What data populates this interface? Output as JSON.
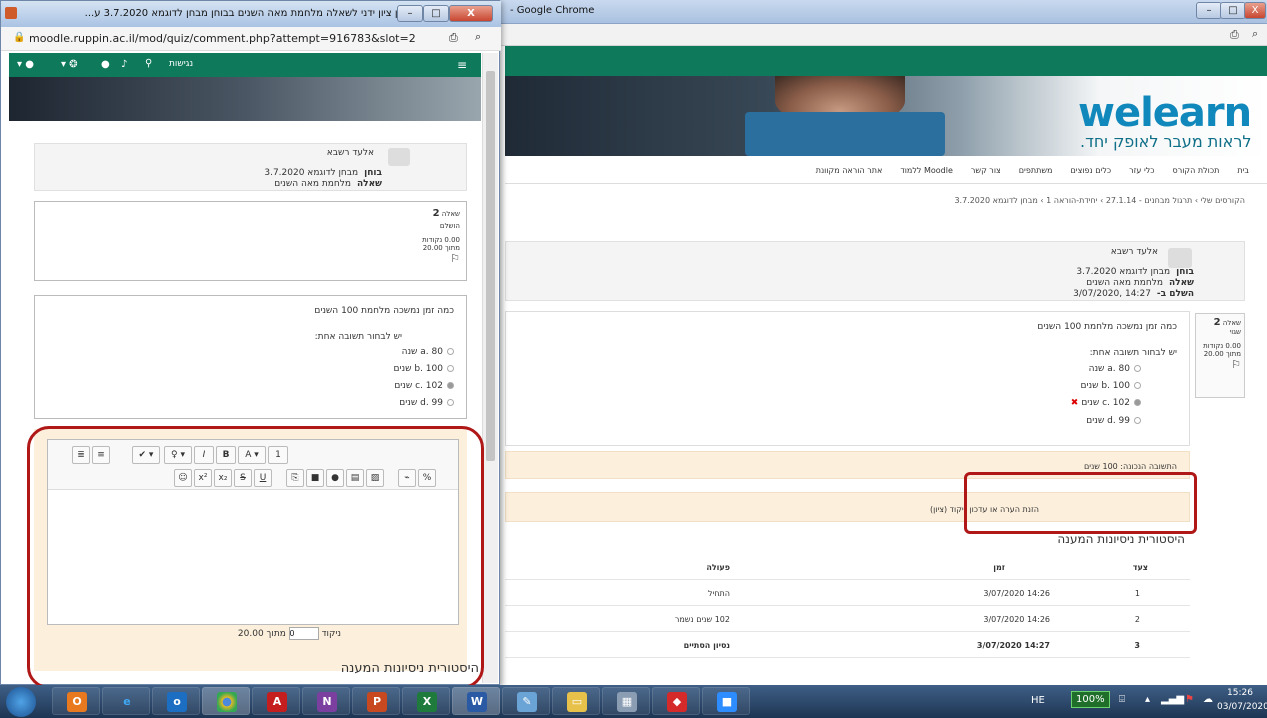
{
  "bg_window": {
    "title": "- Google Chrome",
    "min": "–",
    "max": "□",
    "close": "X"
  },
  "bg_nav": [
    "בית",
    "תכולת הקורס",
    "כלי עזר",
    "כלים נפוצים",
    "משתתפים",
    "צור קשר",
    "ללמוד Moodle",
    "אתר הוראה מקוונת"
  ],
  "bg_breadcrumb": "הקורסים שלי › תרגול מבחנים - 27.1.14 › יחידת-הוראה 1 › מבחן לדוגמא 3.7.2020",
  "logo": {
    "text": "welearn",
    "sub": "לראות מעבר לאופק יחד."
  },
  "bg_info": {
    "name": "אלעד רשבא",
    "exam_label": "בוחן",
    "exam_value": "מבחן לדוגמא 3.7.2020",
    "question_label": "שאלה",
    "question_value": "מלחמת מאה השנים",
    "completed_label": "השלם ב-",
    "completed_value": "14:27 ,3/07/2020"
  },
  "bg_qbox": {
    "label": "שאלה",
    "number": "2",
    "status": "שגוי",
    "points": "0.00 נקודות",
    "outof": "מתוך 20.00",
    "flag": "⚐"
  },
  "question": {
    "text": "כמה זמן נמשכה מלחמת 100 השנים",
    "prompt": "יש לבחור תשובה אחת:",
    "options": [
      "a. 80 שנה",
      "b. 100 שנים",
      "c. 102 שנים",
      "d. 99 שנים"
    ],
    "wrong_mark": "✖"
  },
  "correct_answer": "התשובה הנכונה: 100 שנים",
  "comment_link": "הזנת הערה או עדכון ניקוד (ציון)",
  "history": {
    "title": "היסטורית ניסיונות המענה",
    "headers": {
      "step": "צעד",
      "time": "זמן",
      "action": "פעולה"
    },
    "rows": [
      {
        "step": "1",
        "time": "14:26 3/07/2020",
        "action": "התחיל"
      },
      {
        "step": "2",
        "time": "14:26 3/07/2020",
        "action": "102 שנים  נשמר"
      },
      {
        "step": "3",
        "time": "14:27 3/07/2020",
        "action": "נסיון הסתיים"
      }
    ]
  },
  "popup": {
    "title": "מתן ציון ידני לשאלה מלחמת מאה השנים בבוחן מבחן לדוגמא 3.7.2020 ע...",
    "url": "moodle.ruppin.ac.il/mod/quiz/comment.php?attempt=916783&slot=2",
    "access": "נגישות",
    "min": "–",
    "max": "□",
    "close": "X",
    "name": "אלעד רשבא",
    "exam_label": "בוחן",
    "exam_value": "מבחן לדוגמא 3.7.2020",
    "question_label": "שאלה",
    "question_value": "מלחמת מאה השנים",
    "q_label": "שאלה",
    "q_number": "2",
    "q_status": "הושלם",
    "q_points": "0.00 נקודות",
    "q_outof": "מתוך 20.00",
    "flag": "⚐",
    "mark_label": "ניקוד",
    "mark_value": "0",
    "mark_outof": "מתוך 20.00",
    "history_title": "היסטורית ניסיונות המענה"
  },
  "editor_toolbar": {
    "row1": [
      "1",
      "A ▾",
      "B",
      "I",
      "♀ ▾",
      "✔ ▾",
      "≡",
      "≣"
    ],
    "row2": [
      "☺",
      "x²",
      "x₂",
      "S",
      "U",
      "⎘",
      "■",
      "●",
      "▤",
      "▨",
      "⌁",
      "%"
    ]
  },
  "taskbar": {
    "lang": "HE",
    "battery": "100%",
    "time": "15:26",
    "date": "03/07/2020"
  }
}
